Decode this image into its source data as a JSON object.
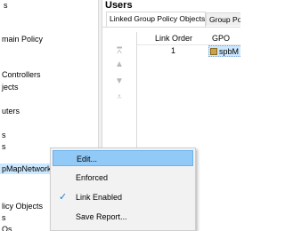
{
  "tree": {
    "items": [
      {
        "label": "s"
      },
      {
        "label": "main Policy"
      },
      {
        "label": "Controllers"
      },
      {
        "label": "jects"
      },
      {
        "label": "uters"
      },
      {
        "label": "s"
      },
      {
        "label": "s"
      },
      {
        "label": "pMapNetworkDisks",
        "selected": true
      },
      {
        "label": "licy Objects"
      },
      {
        "label": "s"
      },
      {
        "label": "Os"
      }
    ]
  },
  "right_pane": {
    "title": "Users",
    "tabs": [
      {
        "label": "Linked Group Policy Objects",
        "active": true
      },
      {
        "label": "Group Po"
      }
    ],
    "columns": [
      {
        "label": "Link Order"
      },
      {
        "label": "GPO"
      }
    ],
    "rows": [
      {
        "link_order": "1",
        "gpo": "spbM"
      }
    ]
  },
  "context_menu": {
    "items": [
      {
        "label": "Edit...",
        "hover": true
      },
      {
        "label": "Enforced"
      },
      {
        "label": "Link Enabled",
        "checked": true
      },
      {
        "label": "Save Report..."
      }
    ]
  }
}
